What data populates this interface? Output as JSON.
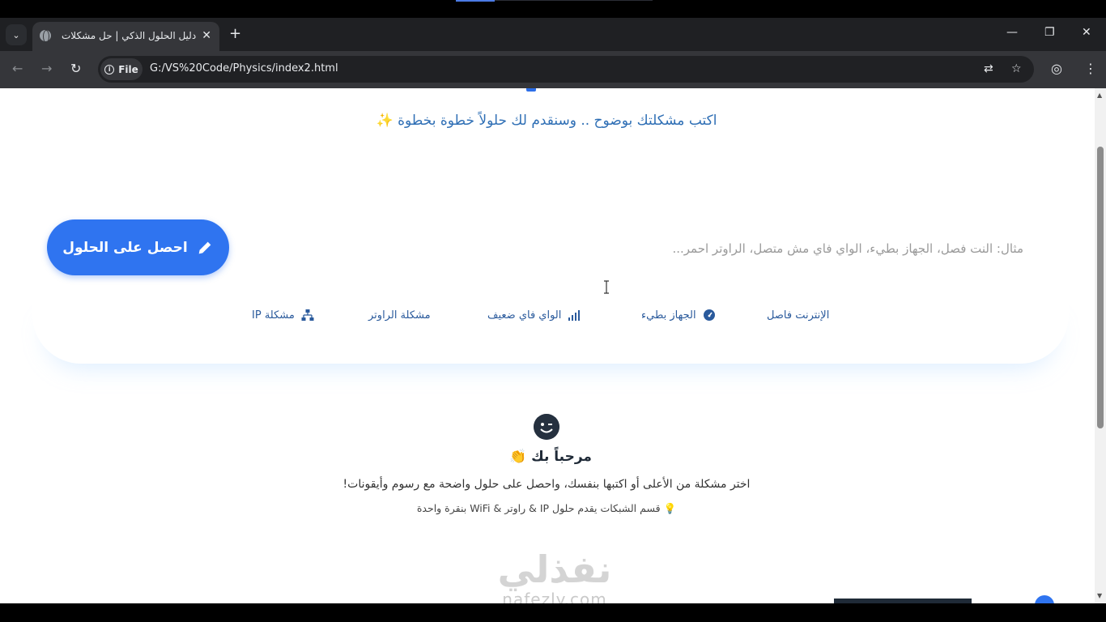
{
  "browser": {
    "tab_title": "دليل الحلول الذكي | حل مشكلات",
    "tab_close": "✕",
    "new_tab": "+",
    "scheme_chip": "File",
    "url": "G:/VS%20Code/Physics/index2.html",
    "window_controls": {
      "minimize": "—",
      "restore": "❐",
      "close": "✕"
    }
  },
  "page": {
    "subtitle": "اكتب مشكلتك بوضوح .. وسنقدم لك حلولاً خطوة بخطوة",
    "input_placeholder": "مثال: النت فصل، الجهاز بطيء، الواي فاي مش متصل، الراوتر احمر...",
    "get_solutions_label": "احصل على الحلول",
    "quick_chips": [
      {
        "label": "الإنترنت فاصل",
        "icon": ""
      },
      {
        "label": "الجهاز بطيء",
        "icon": "speedometer-icon"
      },
      {
        "label": "الواي فاي ضعيف",
        "icon": "signal-icon"
      },
      {
        "label": "مشكلة الراوتر",
        "icon": ""
      },
      {
        "label": "مشكلة IP",
        "icon": "network-icon"
      }
    ],
    "welcome": {
      "title": "مرحباً بك 👏",
      "description": "اختر مشكلة من الأعلى أو اكتبها بنفسك، واحصل على حلول واضحة مع رسوم وأيقونات!",
      "tip": "قسم الشبكات يقدم حلول IP & راوتر & WiFi بنقرة واحدة"
    }
  },
  "watermark": {
    "logo_text": "نفذلي",
    "url": "nafezly.com"
  }
}
